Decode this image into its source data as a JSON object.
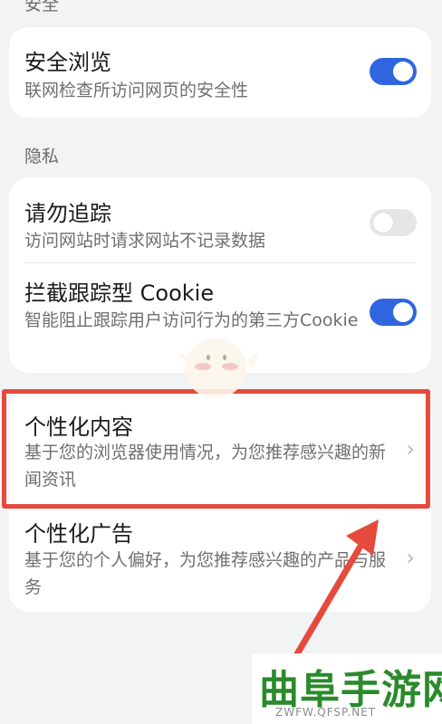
{
  "sections": {
    "security_label": "安全",
    "privacy_label": "隐私"
  },
  "safe_browsing": {
    "title": "安全浏览",
    "desc": "联网检查所访问网页的安全性",
    "enabled": true
  },
  "do_not_track": {
    "title": "请勿追踪",
    "desc": "访问网站时请求网站不记录数据",
    "enabled": false
  },
  "block_cookies": {
    "title": "拦截跟踪型 Cookie",
    "desc": "智能阻止跟踪用户访问行为的第三方Cookie",
    "enabled": true
  },
  "personalized_content": {
    "title": "个性化内容",
    "desc": "基于您的浏览器使用情况，为您推荐感兴趣的新闻资讯"
  },
  "personalized_ads": {
    "title": "个性化广告",
    "desc": "基于您的个人偏好，为您推荐感兴趣的产品与服务"
  },
  "colors": {
    "toggle_on": "#2f66e0",
    "toggle_off": "#e6e6e6",
    "highlight": "#e64a3c",
    "arrow": "#e64a3c",
    "watermark": "#2b8a2b"
  },
  "watermark": {
    "text": "曲阜手游网",
    "url": "ZWFW.QFSP.NET"
  }
}
